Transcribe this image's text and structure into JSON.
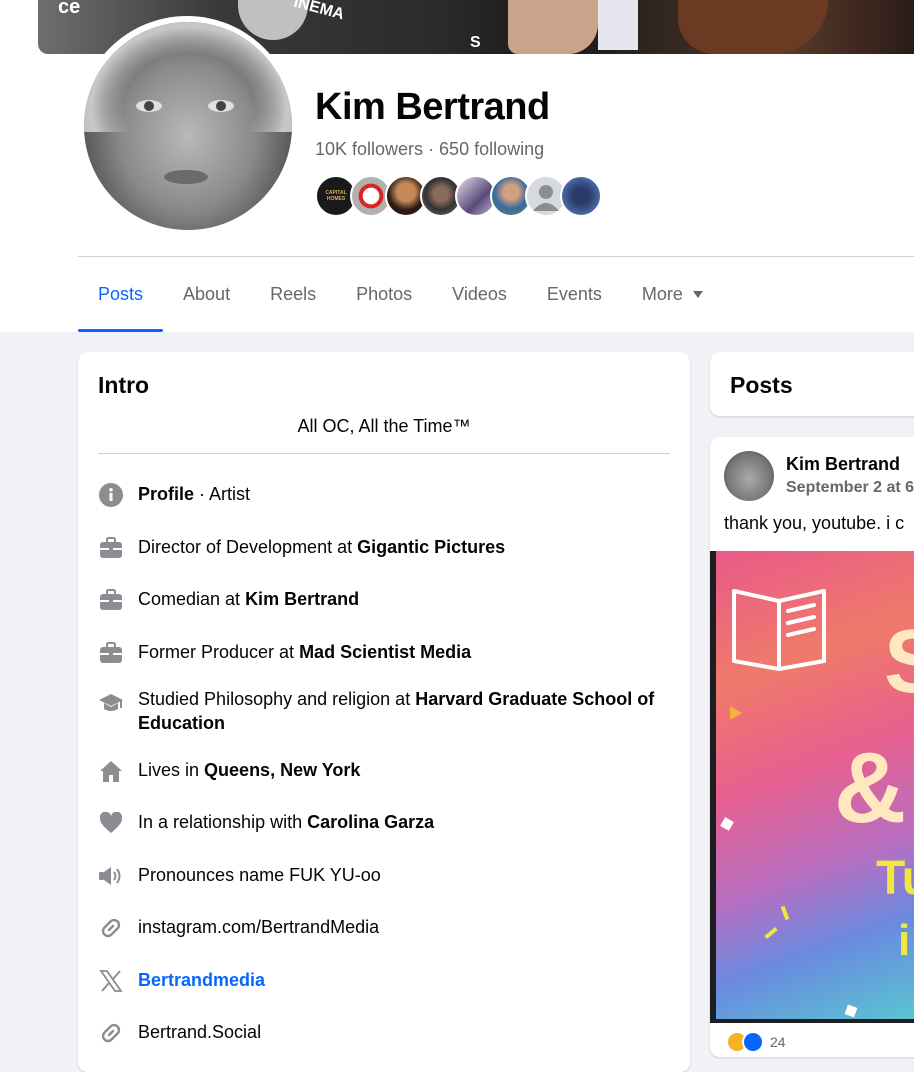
{
  "profile": {
    "name": "Kim Bertrand",
    "followers_line": "10K followers · 650 following"
  },
  "cover_texts": [
    "ce",
    "INEMA",
    "S"
  ],
  "tabs": [
    {
      "label": "Posts"
    },
    {
      "label": "About"
    },
    {
      "label": "Reels"
    },
    {
      "label": "Photos"
    },
    {
      "label": "Videos"
    },
    {
      "label": "Events"
    },
    {
      "label": "More"
    }
  ],
  "friend_avatar_captions": [
    "CAPITAL HOMES"
  ],
  "intro": {
    "title": "Intro",
    "bio": "All OC, All the Time™",
    "items": [
      {
        "icon": "info-icon",
        "pre": "",
        "bold": "Profile",
        "post": " · Artist"
      },
      {
        "icon": "briefcase-icon",
        "pre": "Director of Development at ",
        "bold": "Gigantic Pictures",
        "post": ""
      },
      {
        "icon": "briefcase-icon",
        "pre": "Comedian at ",
        "bold": "Kim Bertrand",
        "post": ""
      },
      {
        "icon": "briefcase-icon",
        "pre": "Former Producer at ",
        "bold": "Mad Scientist Media",
        "post": ""
      },
      {
        "icon": "graduation-cap-icon",
        "pre": "Studied Philosophy and religion at ",
        "bold": "Harvard Graduate School of Education",
        "post": ""
      },
      {
        "icon": "home-icon",
        "pre": "Lives in ",
        "bold": "Queens, New York",
        "post": ""
      },
      {
        "icon": "heart-icon",
        "pre": "In a relationship with ",
        "bold": "Carolina Garza",
        "post": ""
      },
      {
        "icon": "speaker-icon",
        "pre": "Pronounces name FUK YU-oo",
        "bold": "",
        "post": ""
      },
      {
        "icon": "link-icon",
        "pre": "instagram.com/BertrandMedia",
        "bold": "",
        "post": ""
      },
      {
        "icon": "x-logo-icon",
        "link": "Bertrandmedia"
      },
      {
        "icon": "link-icon",
        "pre": "Bertrand.Social",
        "bold": "",
        "post": ""
      }
    ]
  },
  "posts_section": {
    "title": "Posts",
    "post": {
      "author": "Kim Bertrand",
      "date": "September 2 at 6",
      "text": "thank you, youtube. i c",
      "reaction_count": "24",
      "image_texts": [
        "S",
        "&",
        "Tu",
        "i"
      ]
    }
  }
}
